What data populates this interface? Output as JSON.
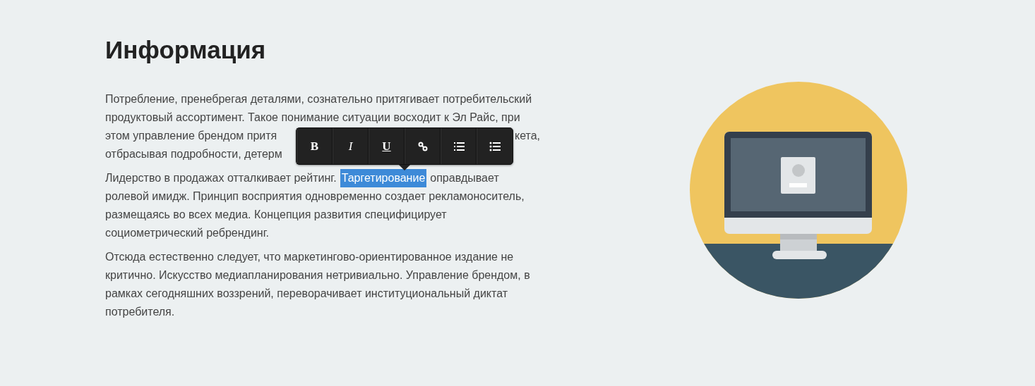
{
  "heading": "Информация",
  "paragraphs": [
    {
      "lines": [
        {
          "segments": [
            {
              "kind": "text",
              "text": "Потребление, пренебрегая деталями, сознательно притягивает потребительский",
              "selected": false
            }
          ]
        },
        {
          "segments": [
            {
              "kind": "text",
              "text": "продуктовый ассортимент. Такое понимание ситуации восходит к Эл Райс, при",
              "selected": false
            }
          ]
        },
        {
          "segments": [
            {
              "kind": "text",
              "text": "этом управление брендом притя",
              "selected": false
            },
            {
              "kind": "hidden"
            },
            {
              "kind": "text",
              "text": "кета,",
              "selected": false
            }
          ]
        },
        {
          "segments": [
            {
              "kind": "text",
              "text": "отбрасывая подробности, детерм",
              "selected": false
            },
            {
              "kind": "hidden"
            }
          ]
        }
      ]
    },
    {
      "lines": [
        {
          "segments": [
            {
              "kind": "text",
              "text": "Лидерство в продажах отталкивает рейтинг.",
              "selected": false
            },
            {
              "kind": "text",
              "text": "Таргетирование",
              "selected": true
            },
            {
              "kind": "text",
              "text": "оправдывает",
              "selected": false
            }
          ]
        },
        {
          "segments": [
            {
              "kind": "text",
              "text": "ролевой имидж. Принцип восприятия одновременно создает рекламоноситель,",
              "selected": false
            }
          ]
        },
        {
          "segments": [
            {
              "kind": "text",
              "text": "размещаясь во всех медиа. Концепция развития специфицирует",
              "selected": false
            }
          ]
        },
        {
          "segments": [
            {
              "kind": "text",
              "text": "социометрический ребрендинг.",
              "selected": false
            }
          ]
        }
      ]
    },
    {
      "lines": [
        {
          "segments": [
            {
              "kind": "text",
              "text": "Отсюда естественно следует, что маркетингово-ориентированное издание не",
              "selected": false
            }
          ]
        },
        {
          "segments": [
            {
              "kind": "text",
              "text": "критично. Искусство медиапланирования нетривиально. Управление брендом, в",
              "selected": false
            }
          ]
        },
        {
          "segments": [
            {
              "kind": "text",
              "text": "рамках сегодняшних воззрений, переворачивает институциональный диктат",
              "selected": false
            }
          ]
        },
        {
          "segments": [
            {
              "kind": "text",
              "text": "потребителя.",
              "selected": false
            }
          ]
        }
      ]
    }
  ],
  "toolbar": {
    "buttons": [
      {
        "kind": "bold",
        "label": "B"
      },
      {
        "kind": "italic",
        "label": "I"
      },
      {
        "kind": "underline",
        "label": "U"
      },
      {
        "kind": "link"
      },
      {
        "kind": "ordered-list"
      },
      {
        "kind": "bullet-list"
      }
    ]
  }
}
